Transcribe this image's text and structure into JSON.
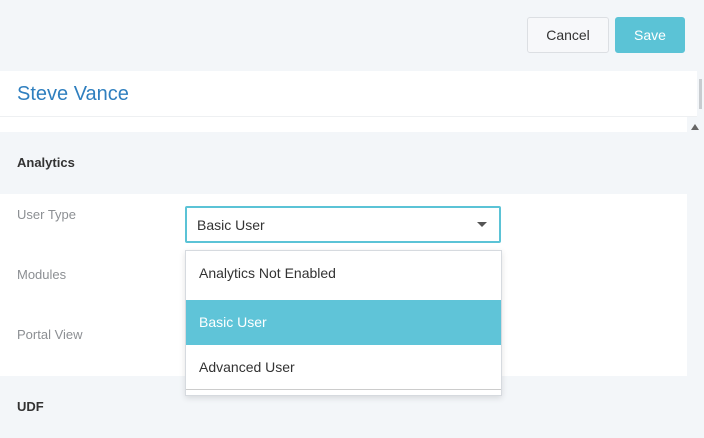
{
  "toolbar": {
    "cancel_label": "Cancel",
    "save_label": "Save"
  },
  "header": {
    "title": "Steve Vance"
  },
  "sections": {
    "analytics": {
      "heading": "Analytics",
      "fields": {
        "user_type_label": "User Type",
        "modules_label": "Modules",
        "portal_view_label": "Portal View"
      },
      "user_type_select": {
        "value": "Basic User",
        "options": [
          "Analytics Not Enabled",
          "Basic User",
          "Advanced User"
        ],
        "selected_index": 1
      }
    },
    "udf": {
      "heading": "UDF"
    }
  },
  "colors": {
    "accent": "#5bc3d6",
    "title": "#2f7fbf",
    "panel_bg": "#f3f6f9"
  }
}
